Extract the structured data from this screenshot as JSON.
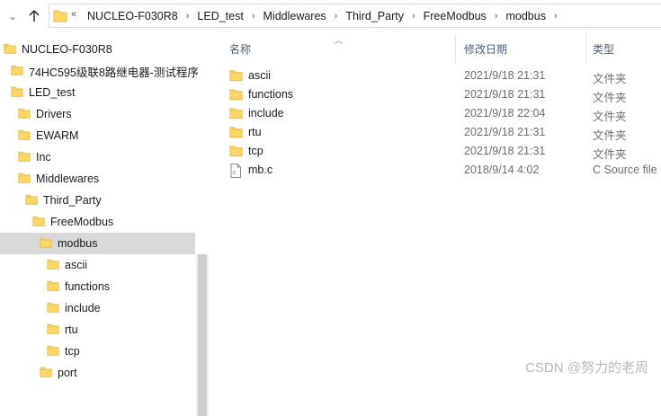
{
  "address_bar": {
    "overflow_glyph": "«",
    "crumbs": [
      "NUCLEO-F030R8",
      "LED_test",
      "Middlewares",
      "Third_Party",
      "FreeModbus",
      "modbus"
    ],
    "separator": "›"
  },
  "nav_pane": {
    "items": [
      {
        "label": "NUCLEO-F030R8"
      },
      {
        "label": "74HC595级联8路继电器-测试程序"
      },
      {
        "label": "LED_test"
      },
      {
        "label": "Drivers"
      },
      {
        "label": "EWARM"
      },
      {
        "label": "Inc"
      },
      {
        "label": "Middlewares"
      },
      {
        "label": "Third_Party"
      },
      {
        "label": "FreeModbus"
      },
      {
        "label": "modbus",
        "selected": true
      },
      {
        "label": "ascii"
      },
      {
        "label": "functions"
      },
      {
        "label": "include"
      },
      {
        "label": "rtu"
      },
      {
        "label": "tcp"
      },
      {
        "label": "port"
      }
    ]
  },
  "file_list": {
    "columns": {
      "name": "名称",
      "date": "修改日期",
      "type": "类型"
    },
    "rows": [
      {
        "name": "ascii",
        "date": "2021/9/18 21:31",
        "type": "文件夹",
        "icon": "folder-icon"
      },
      {
        "name": "functions",
        "date": "2021/9/18 21:31",
        "type": "文件夹",
        "icon": "folder-icon"
      },
      {
        "name": "include",
        "date": "2021/9/18 22:04",
        "type": "文件夹",
        "icon": "folder-icon"
      },
      {
        "name": "rtu",
        "date": "2021/9/18 21:31",
        "type": "文件夹",
        "icon": "folder-icon"
      },
      {
        "name": "tcp",
        "date": "2021/9/18 21:31",
        "type": "文件夹",
        "icon": "folder-icon"
      },
      {
        "name": "mb.c",
        "date": "2018/9/14 4:02",
        "type": "C Source file",
        "icon": "c-source-file-icon"
      }
    ]
  },
  "watermark": "CSDN @努力的老周",
  "colors": {
    "folder": "#ffd766",
    "folder_edge": "#e8b83a",
    "selected_row": "#d9d9d9",
    "header_text": "#4c607a"
  }
}
